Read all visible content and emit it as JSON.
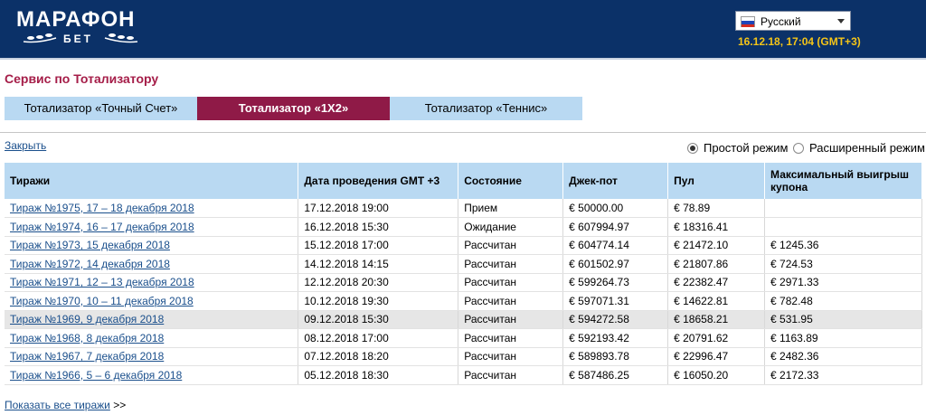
{
  "header": {
    "logo_main": "МАРАФОН",
    "logo_sub": "БЕТ",
    "language": "Русский",
    "datetime": "16.12.18,  17:04 (GMT+3)"
  },
  "page_title": "Сервис по Тотализатору",
  "tabs": [
    {
      "label": "Тотализатор «Точный Счет»",
      "active": false
    },
    {
      "label": "Тотализатор «1Х2»",
      "active": true
    },
    {
      "label": "Тотализатор «Теннис»",
      "active": false
    }
  ],
  "close_label": "Закрыть",
  "modes": {
    "simple": "Простой режим",
    "extended": "Расширенный режим",
    "selected": "simple"
  },
  "table": {
    "headers": [
      "Тиражи",
      "Дата проведения GMT +3",
      "Состояние",
      "Джек-пот",
      "Пул",
      "Максимальный выигрыш купона"
    ],
    "rows": [
      [
        "Тираж №1975, 17 – 18 декабря 2018",
        "17.12.2018 19:00",
        "Прием",
        "€ 50000.00",
        "€ 78.89",
        ""
      ],
      [
        "Тираж №1974, 16 – 17 декабря 2018",
        "16.12.2018 15:30",
        "Ожидание",
        "€ 607994.97",
        "€ 18316.41",
        ""
      ],
      [
        "Тираж №1973, 15 декабря 2018",
        "15.12.2018 17:00",
        "Рассчитан",
        "€ 604774.14",
        "€ 21472.10",
        "€ 1245.36"
      ],
      [
        "Тираж №1972, 14 декабря 2018",
        "14.12.2018 14:15",
        "Рассчитан",
        "€ 601502.97",
        "€ 21807.86",
        "€ 724.53"
      ],
      [
        "Тираж №1971, 12 – 13 декабря 2018",
        "12.12.2018 20:30",
        "Рассчитан",
        "€ 599264.73",
        "€ 22382.47",
        "€ 2971.33"
      ],
      [
        "Тираж №1970, 10 – 11 декабря 2018",
        "10.12.2018 19:30",
        "Рассчитан",
        "€ 597071.31",
        "€ 14622.81",
        "€ 782.48"
      ],
      [
        "Тираж №1969, 9 декабря 2018",
        "09.12.2018 15:30",
        "Рассчитан",
        "€ 594272.58",
        "€ 18658.21",
        "€ 531.95"
      ],
      [
        "Тираж №1968, 8 декабря 2018",
        "08.12.2018 17:00",
        "Рассчитан",
        "€ 592193.42",
        "€ 20791.62",
        "€ 1163.89"
      ],
      [
        "Тираж №1967, 7 декабря 2018",
        "07.12.2018 18:20",
        "Рассчитан",
        "€ 589893.78",
        "€ 22996.47",
        "€ 2482.36"
      ],
      [
        "Тираж №1966, 5 – 6 декабря 2018",
        "05.12.2018 18:30",
        "Рассчитан",
        "€ 587486.25",
        "€ 16050.20",
        "€ 2172.33"
      ]
    ],
    "highlighted_row": 6
  },
  "show_all_label": "Показать все тиражи",
  "show_all_suffix": ">>",
  "colors": {
    "header_bg": "#0b3168",
    "accent": "#8f1a47",
    "tab_bg": "#b9d9f2",
    "datetime": "#f5c518",
    "link": "#1a4f8c"
  }
}
